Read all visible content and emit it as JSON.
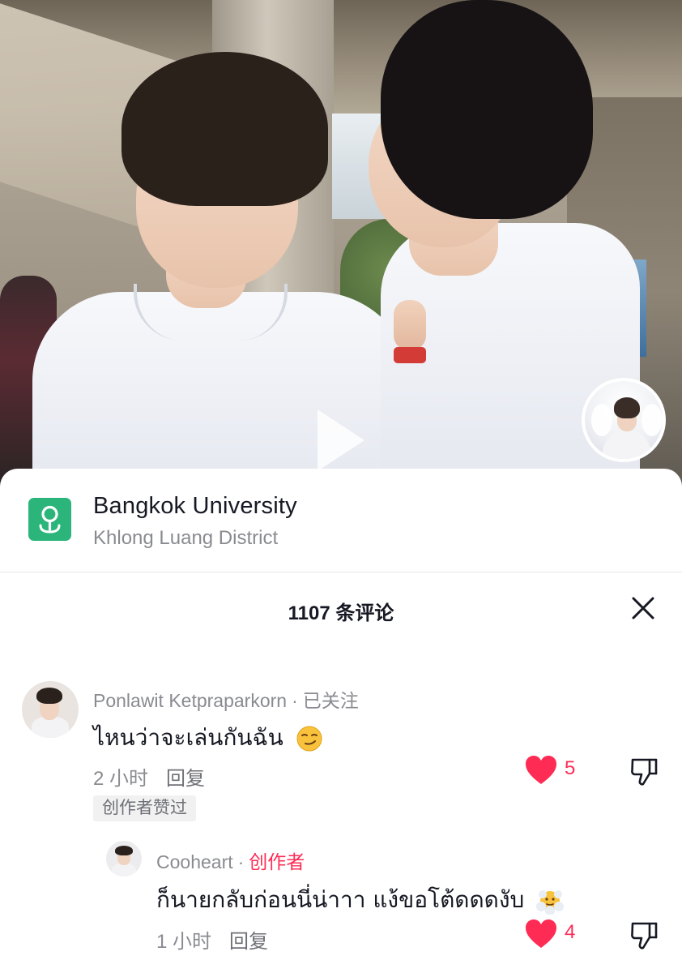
{
  "location": {
    "title": "Bangkok University",
    "subtitle": "Khlong Luang District"
  },
  "comments_header": "1107 条评论",
  "comments": [
    {
      "author": "Ponlawit Ketpraparkorn",
      "separator": "·",
      "tag": "已关注",
      "text": "ไหนว่าจะเล่นกันฉัน",
      "emoji": "smirking-face",
      "time": "2 小时",
      "reply_label": "回复",
      "likes": "5",
      "liked": true,
      "badge": "创作者赞过"
    },
    {
      "author": "Cooheart",
      "separator": "·",
      "tag": "创作者",
      "text": "ก็นายกลับก่อนนี่น่าาา แง้ขอโต้ดดดงับ",
      "emoji": "face-in-clouds",
      "time": "1 小时",
      "reply_label": "回复",
      "likes": "4",
      "liked": true
    }
  ],
  "colors": {
    "accent": "#fe2c55",
    "location_icon": "#2bb57a",
    "muted_text": "#8a8b91"
  }
}
